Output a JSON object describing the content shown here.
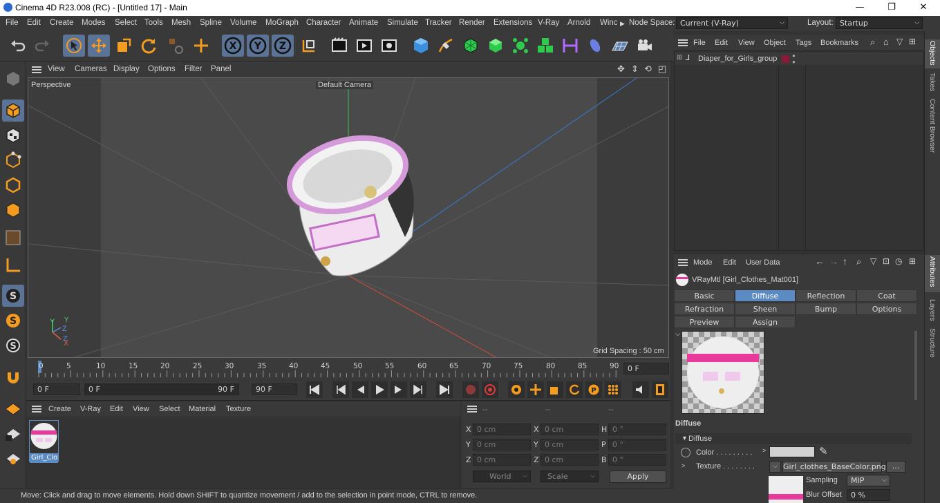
{
  "window": {
    "title": "Cinema 4D R23.008 (RC) - [Untitled 17] - Main",
    "minimize": "—",
    "maximize": "❐",
    "close": "✕"
  },
  "menubar": {
    "items": [
      "File",
      "Edit",
      "Create",
      "Modes",
      "Select",
      "Tools",
      "Mesh",
      "Spline",
      "Volume",
      "MoGraph",
      "Character",
      "Animate",
      "Simulate",
      "Tracker",
      "Render",
      "Extensions",
      "V-Ray",
      "Arnold",
      "Winc"
    ],
    "node_space_label": "Node Space:",
    "node_space_value": "Current (V-Ray)",
    "layout_label": "Layout:",
    "layout_value": "Startup"
  },
  "viewport": {
    "menu": [
      "View",
      "Cameras",
      "Display",
      "Options",
      "Filter",
      "Panel"
    ],
    "view_name": "Perspective",
    "camera": "Default Camera",
    "grid_spacing": "Grid Spacing : 50 cm",
    "axis_labels": [
      "Y",
      "Z",
      "X"
    ]
  },
  "timeline": {
    "ticks": [
      "0",
      "5",
      "10",
      "15",
      "20",
      "25",
      "30",
      "35",
      "40",
      "45",
      "50",
      "55",
      "60",
      "65",
      "70",
      "75",
      "80",
      "85",
      "90"
    ],
    "current_frame": "0 F"
  },
  "playback": {
    "start": "0 F",
    "range_start": "0 F",
    "range_end": "90 F",
    "end": "90 F"
  },
  "material_manager": {
    "menu": [
      "Create",
      "V-Ray",
      "Edit",
      "View",
      "Select",
      "Material",
      "Texture"
    ],
    "material_name": "Girl_Clot"
  },
  "coordinates": {
    "headers": [
      "--",
      "--",
      "--"
    ],
    "rows": [
      {
        "l1": "X",
        "v1": "0 cm",
        "l2": "X",
        "v2": "0 cm",
        "l3": "H",
        "v3": "0 °"
      },
      {
        "l1": "Y",
        "v1": "0 cm",
        "l2": "Y",
        "v2": "0 cm",
        "l3": "P",
        "v3": "0 °"
      },
      {
        "l1": "Z",
        "v1": "0 cm",
        "l2": "Z",
        "v2": "0 cm",
        "l3": "B",
        "v3": "0 °"
      }
    ],
    "space": "World",
    "mode": "Scale",
    "apply": "Apply"
  },
  "objects_panel": {
    "menu": [
      "File",
      "Edit",
      "View",
      "Object",
      "Tags",
      "Bookmarks"
    ],
    "item": "Diaper_for_Girls_group",
    "item_color": "#8b1a3a"
  },
  "side_tabs": {
    "objects": "Objects",
    "takes": "Takes",
    "content_browser": "Content Browser",
    "attributes": "Attributes",
    "layers": "Layers",
    "structure": "Structure"
  },
  "attributes": {
    "menu": [
      "Mode",
      "Edit",
      "User Data"
    ],
    "material_title": "VRayMtl [Girl_Clothes_Mat001]",
    "tabs_row1": [
      "Basic",
      "Diffuse",
      "Reflection",
      "Coat"
    ],
    "tabs_row2": [
      "Refraction",
      "Sheen",
      "Bump",
      "Options"
    ],
    "tabs_row3": [
      "Preview Settings",
      "Assign"
    ],
    "active_tab": "Diffuse",
    "section": "Diffuse",
    "group": "Diffuse",
    "color_label": "Color . . . . . . . . .",
    "texture_label": "Texture . . . . . . . .",
    "texture_file": "Girl_clothes_BaseColor.png",
    "texture_more": "...",
    "sampling_label": "Sampling",
    "sampling_value": "MIP",
    "blur_label": "Blur Offset",
    "blur_value": "0 %"
  },
  "status": {
    "text": "Move: Click and drag to move elements. Hold down SHIFT to quantize movement / add to the selection in point mode, CTRL to remove."
  },
  "colors": {
    "accent": "#5c8bc4",
    "orange": "#f39c1f",
    "selected_tool": "#5a7396"
  }
}
